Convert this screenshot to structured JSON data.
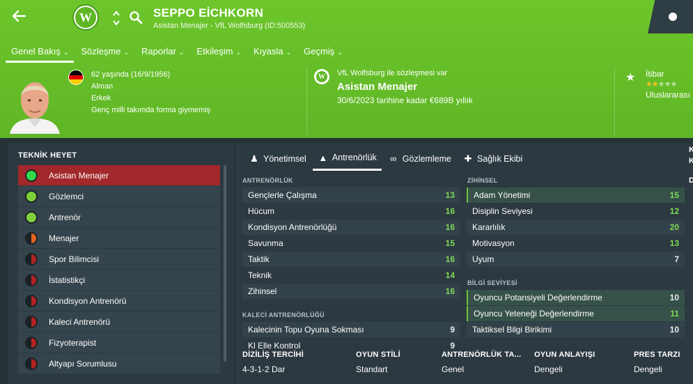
{
  "header": {
    "name": "SEPPO EİCHKORN",
    "subtitle": "Asistan Menajer - VfL Wolfsburg (ID:500553)",
    "club_initial": "W",
    "nav": [
      {
        "label": "Genel Bakış",
        "active": true
      },
      {
        "label": "Sözleşme"
      },
      {
        "label": "Raporlar"
      },
      {
        "label": "Etkileşim"
      },
      {
        "label": "Kıyasla"
      },
      {
        "label": "Geçmiş"
      }
    ]
  },
  "profile": {
    "age_line": "62 yaşında (16/9/1956)",
    "nationality": "Alman",
    "gender": "Erkek",
    "intl": "Genç milli takımda forma giymemiş",
    "contract_line": "VfL Wolfsburg ile sözleşmesi var",
    "contract_role": "Asistan Menajer",
    "contract_until": "30/6/2023 tarihine kadar €689B yıllık",
    "reputation_label": "İtibar",
    "reputation_stars": 2,
    "reputation_value": "Uluslararası"
  },
  "staff_panel": {
    "title": "TEKNİK HEYET",
    "items": [
      {
        "label": "Asistan Menajer",
        "color": "#34d84a",
        "active": true
      },
      {
        "label": "Gözlemci",
        "color": "#7fd13b"
      },
      {
        "label": "Antrenör",
        "color": "#7fd13b"
      },
      {
        "label": "Menajer",
        "color": "#e0641e"
      },
      {
        "label": "Spor Bilimcisi",
        "color": "#b32222"
      },
      {
        "label": "İstatistikçi",
        "color": "#b32222"
      },
      {
        "label": "Kondisyon Antrenörü",
        "color": "#b32222"
      },
      {
        "label": "Kaleci Antrenörü",
        "color": "#b32222"
      },
      {
        "label": "Fizyoterapist",
        "color": "#b32222"
      },
      {
        "label": "Altyapı Sorumlusu",
        "color": "#b32222"
      }
    ]
  },
  "tabs": [
    {
      "label": "Yönetimsel",
      "icon": "person-icon"
    },
    {
      "label": "Antrenörlük",
      "icon": "cone-icon",
      "active": true
    },
    {
      "label": "Gözlemleme",
      "icon": "binoculars-icon"
    },
    {
      "label": "Sağlık Ekibi",
      "icon": "medkit-icon"
    }
  ],
  "coaching": {
    "title": "ANTRENÖRLÜK",
    "rows": [
      {
        "label": "Gençlerle Çalışma",
        "value": "13"
      },
      {
        "label": "Hücum",
        "value": "16"
      },
      {
        "label": "Kondisyon Antrenörlüğü",
        "value": "16"
      },
      {
        "label": "Savunma",
        "value": "15"
      },
      {
        "label": "Taktik",
        "value": "16"
      },
      {
        "label": "Teknik",
        "value": "14"
      },
      {
        "label": "Zihinsel",
        "value": "16"
      }
    ]
  },
  "gk_coaching": {
    "title": "KALECİ ANTRENÖRLÜĞÜ",
    "rows": [
      {
        "label": "Kalecinin Topu Oyuna Sokması",
        "value": "9"
      },
      {
        "label": "Kl Elle Kontrol",
        "value": "9"
      }
    ]
  },
  "mental": {
    "title": "ZİHİNSEL",
    "rows": [
      {
        "label": "Adam Yönetimi",
        "value": "15"
      },
      {
        "label": "Disiplin Seviyesi",
        "value": "12"
      },
      {
        "label": "Kararlılık",
        "value": "20"
      },
      {
        "label": "Motivasyon",
        "value": "13"
      },
      {
        "label": "Uyum",
        "value": "7"
      }
    ]
  },
  "knowledge": {
    "title": "BİLGİ SEVİYESİ",
    "rows": [
      {
        "label": "Oyuncu Potansiyeli Değerlendirme",
        "value": "10"
      },
      {
        "label": "Oyuncu Yeteneği Değerlendirme",
        "value": "11"
      },
      {
        "label": "Taktiksel Bilgi Birikimi",
        "value": "10"
      }
    ]
  },
  "summary": [
    {
      "label": "DİZİLİŞ TERCİHİ",
      "value": "4-3-1-2 Dar"
    },
    {
      "label": "OYUN STİLİ",
      "value": "Standart"
    },
    {
      "label": "ANTRENÖRLÜK TA...",
      "value": "Genel"
    },
    {
      "label": "OYUN ANLAYIŞI",
      "value": "Dengeli"
    },
    {
      "label": "PRES TARZI",
      "value": "Dengeli"
    }
  ],
  "edge": {
    "k1": "K",
    "k2": "K",
    "d": "D"
  },
  "colors": {
    "header_green": "#66c028",
    "accent_green": "#7ed957",
    "active_red": "#a3282b"
  }
}
